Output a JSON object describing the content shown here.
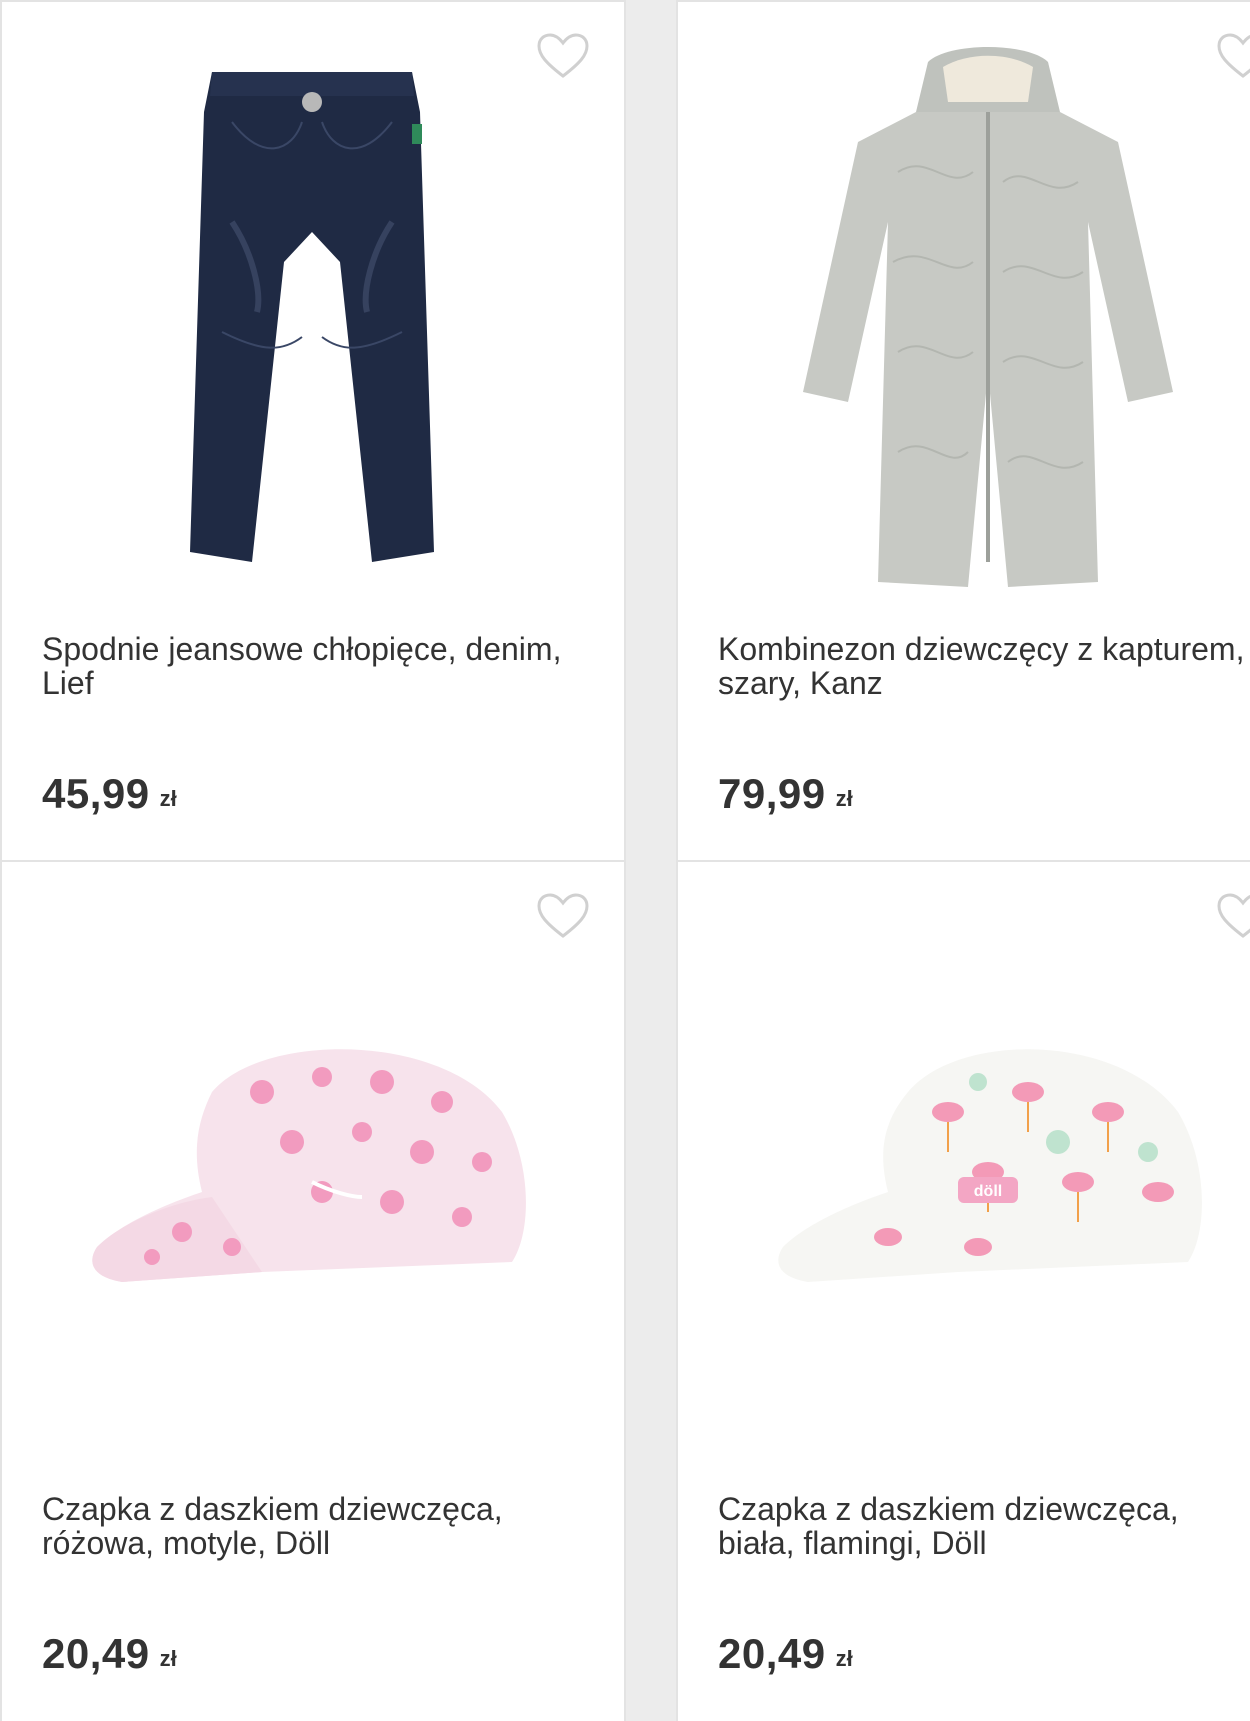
{
  "products": [
    {
      "title": "Spodnie jeansowe chłopięce, denim, Lief",
      "price": "45,99",
      "currency": "zł",
      "favorite_icon": "heart-outline-icon",
      "image": "jeans-pants"
    },
    {
      "title": "Kombinezon dziewczęcy z kapturem, szary, Kanz",
      "price": "79,99",
      "currency": "zł",
      "favorite_icon": "heart-outline-icon",
      "image": "grey-snowsuit"
    },
    {
      "title": "Czapka z daszkiem dziewczęca, różowa, motyle, Döll",
      "price": "20,49",
      "currency": "zł",
      "favorite_icon": "heart-outline-icon",
      "image": "pink-butterfly-cap"
    },
    {
      "title": "Czapka z daszkiem dziewczęca, biała, flamingi, Döll",
      "price": "20,49",
      "currency": "zł",
      "favorite_icon": "heart-outline-icon",
      "image": "white-flamingo-cap",
      "image_label": "döll"
    }
  ],
  "colors": {
    "text": "#333333",
    "card_border": "#e3e3e3",
    "background": "#ececec",
    "heart_stroke": "#d0d0d0"
  }
}
